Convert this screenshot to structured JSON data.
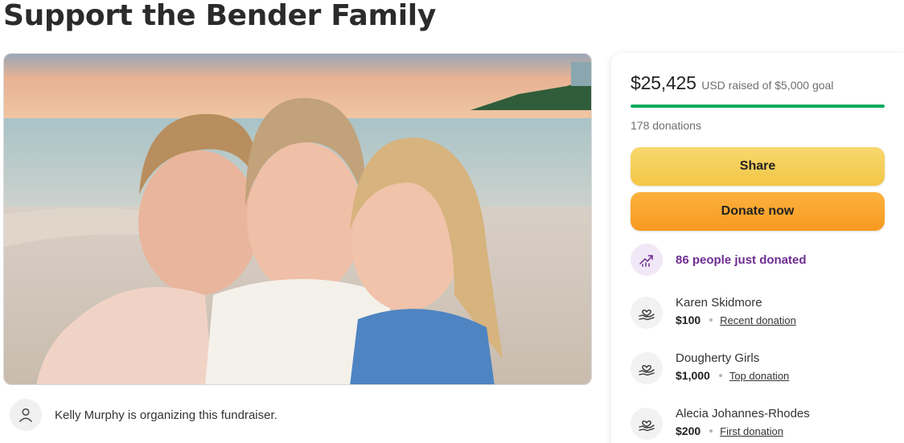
{
  "page": {
    "title": "Support the Bender Family"
  },
  "hero": {
    "image_name": "family-beach-photo"
  },
  "organizer": {
    "text": "Kelly Murphy is organizing this fundraiser.",
    "icon": "user-icon"
  },
  "summary": {
    "amount_raised": "$25,425",
    "raised_label": "USD raised of $5,000 goal",
    "progress_fraction": 1.0,
    "donation_count": "178 donations"
  },
  "actions": {
    "share_label": "Share",
    "donate_label": "Donate now"
  },
  "trend": {
    "text": "86 people just donated",
    "icon": "trending-up-icon"
  },
  "donors": [
    {
      "name": "Karen Skidmore",
      "amount": "$100",
      "tag": "Recent donation",
      "icon": "heart-hand-icon"
    },
    {
      "name": "Dougherty Girls",
      "amount": "$1,000",
      "tag": "Top donation",
      "icon": "heart-hand-icon"
    },
    {
      "name": "Alecia Johannes-Rhodes",
      "amount": "$200",
      "tag": "First donation",
      "icon": "heart-hand-icon"
    }
  ],
  "colors": {
    "progress": "#02a95c",
    "share_button": "#f3c646",
    "donate_button": "#f79a20",
    "trend_text": "#6e2c91",
    "trend_badge": "#f1e8f7"
  }
}
